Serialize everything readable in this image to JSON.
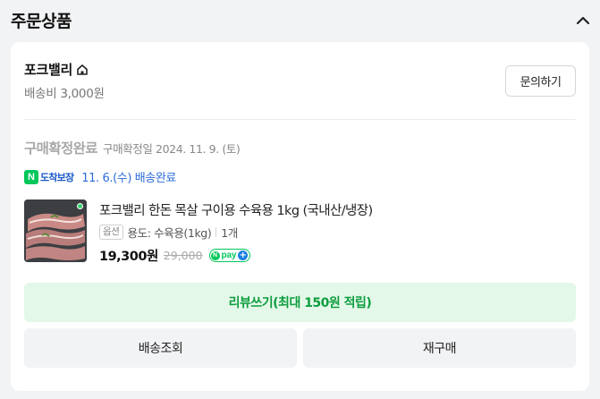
{
  "section": {
    "title": "주문상품",
    "collapse_icon": "chevron-up-icon"
  },
  "store": {
    "name": "포크밸리",
    "home_icon": "home-icon",
    "shipping_fee": "배송비 3,000원",
    "inquiry_label": "문의하기"
  },
  "order": {
    "status": "구매확정완료",
    "confirm_date": "구매확정일 2024. 11. 9. (토)",
    "arrival_badge_n": "N",
    "arrival_badge_label": "도착보장",
    "delivery_info": "11. 6.(수) 배송완료"
  },
  "product": {
    "name": "포크밸리 한돈 목살 구이용 수육용 1kg (국내산/냉장)",
    "option_tag": "옵션",
    "option_value": "용도: 수육용(1kg)",
    "quantity": "1개",
    "price": "19,300원",
    "original_price": "29,000",
    "npay_label": "pay",
    "npay_n": "N",
    "npay_plus": "+"
  },
  "actions": {
    "review": "리뷰쓰기(최대 150원 적립)",
    "track": "배송조회",
    "rebuy": "재구매"
  },
  "colors": {
    "accent_green": "#0f9d3f",
    "review_bg": "#e3f8e9",
    "link_blue": "#2d6bd8",
    "page_bg": "#f2f3f5"
  }
}
